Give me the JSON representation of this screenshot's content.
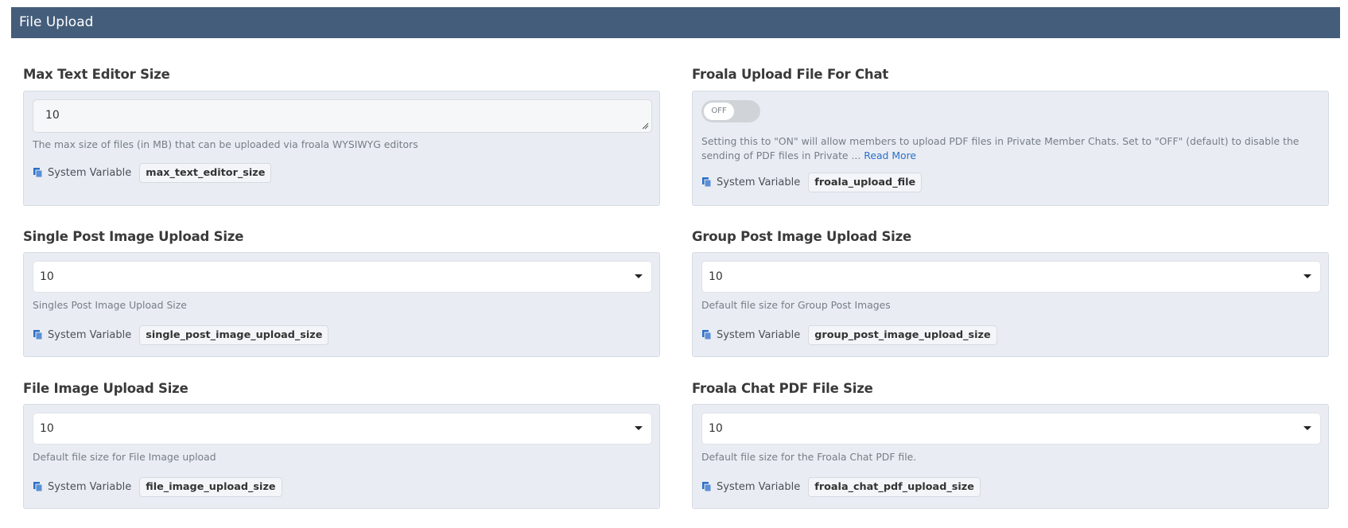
{
  "header": {
    "title": "File Upload"
  },
  "sysvar_label": "System Variable",
  "sections": {
    "max_text_editor": {
      "title": "Max Text Editor Size",
      "value": "10",
      "help": "The max size of files (in MB) that can be uploaded via froala WYSIWYG editors",
      "variable": "max_text_editor_size"
    },
    "froala_upload_chat": {
      "title": "Froala Upload File For Chat",
      "toggle_state": "OFF",
      "help": "Setting this to \"ON\" will allow members to upload PDF files in Private Member Chats.  Set to \"OFF\" (default) to disable the sending of PDF files in Private ...",
      "read_more": "Read More",
      "variable": "froala_upload_file"
    },
    "single_post_image": {
      "title": "Single Post Image Upload Size",
      "value": "10",
      "help": "Singles Post Image Upload Size",
      "variable": "single_post_image_upload_size"
    },
    "group_post_image": {
      "title": "Group Post Image Upload Size",
      "value": "10",
      "help": "Default file size for Group Post Images",
      "variable": "group_post_image_upload_size"
    },
    "file_image": {
      "title": "File Image Upload Size",
      "value": "10",
      "help": "Default file size for File Image upload",
      "variable": "file_image_upload_size"
    },
    "froala_chat_pdf": {
      "title": "Froala Chat PDF File Size",
      "value": "10",
      "help": "Default file size for the Froala Chat PDF file.",
      "variable": "froala_chat_pdf_upload_size"
    }
  },
  "colors": {
    "header_bg": "#445d7a",
    "panel_bg": "#e9edf3",
    "link": "#2c6fc7",
    "icon": "#2c6fc7"
  },
  "icons": {
    "copy": "copy-icon",
    "caret": "chevron-down-icon",
    "grip": "resize-grip-icon"
  }
}
